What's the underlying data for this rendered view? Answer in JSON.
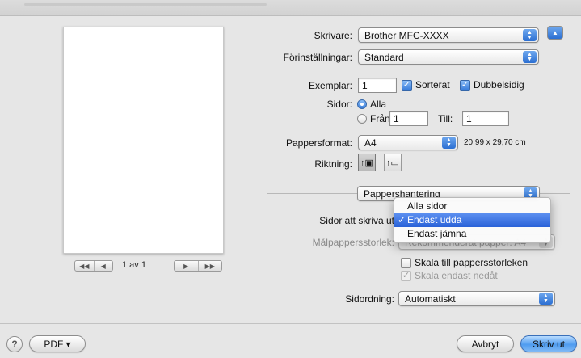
{
  "printer": {
    "label": "Skrivare:",
    "value": "Brother MFC-XXXX"
  },
  "presets": {
    "label": "Förinställningar:",
    "value": "Standard"
  },
  "copies": {
    "label": "Exemplar:",
    "value": "1",
    "collated_label": "Sorterat",
    "collated": true,
    "duplex_label": "Dubbelsidig",
    "duplex": true
  },
  "pages": {
    "label": "Sidor:",
    "all_label": "Alla",
    "from_label": "Från:",
    "from_value": "1",
    "to_label": "Till:",
    "to_value": "1",
    "selected": "all"
  },
  "paper_size": {
    "label": "Pappersformat:",
    "value": "A4",
    "dimensions": "20,99 x 29,70 cm"
  },
  "orientation": {
    "label": "Riktning:",
    "selected": "portrait"
  },
  "panel": {
    "value": "Pappershantering"
  },
  "pages_to_print": {
    "label": "Sidor att skriva ut"
  },
  "dropdown_menu": {
    "items": [
      {
        "label": "Alla sidor",
        "selected": false
      },
      {
        "label": "Endast udda",
        "selected": true
      },
      {
        "label": "Endast jämna",
        "selected": false
      }
    ]
  },
  "destination_paper": {
    "label": "Målpappersstorlek:",
    "value": "Rekommenderat papper: A4"
  },
  "scale_to_fit": {
    "label": "Skala till pappersstorleken",
    "checked": false
  },
  "scale_down_only": {
    "label": "Skala endast nedåt",
    "checked": true
  },
  "page_order": {
    "label": "Sidordning:",
    "value": "Automatiskt"
  },
  "preview_pager": {
    "label": "1 av 1"
  },
  "footer": {
    "pdf_label": "PDF ▾",
    "help_label": "?",
    "cancel_label": "Avbryt",
    "print_label": "Skriv ut"
  },
  "icons": {
    "check": "✓",
    "popup_arrows": "updown-arrows-icon"
  },
  "colors": {
    "accent": "#2c6fd2",
    "selection": "#3a6fe0"
  }
}
